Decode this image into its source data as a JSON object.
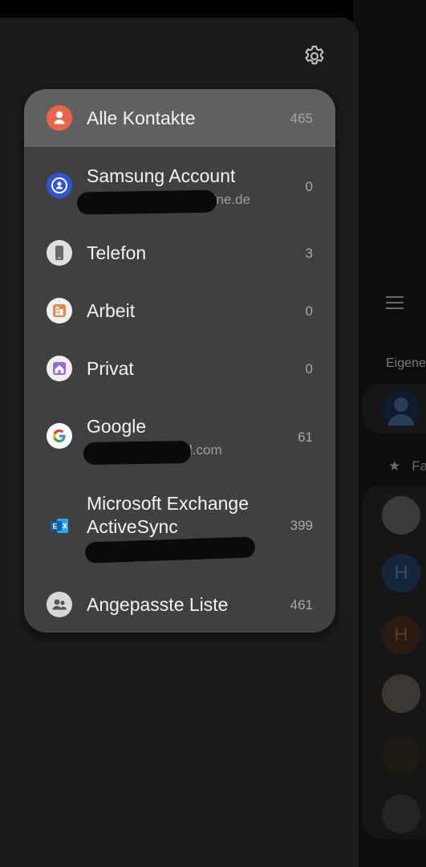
{
  "background_app": {
    "section_label": "Eigene",
    "favorites_label": "Fa",
    "avatar_letter_1": "H",
    "avatar_letter_2": "H"
  },
  "drawer": {
    "settings_icon": "gear-icon"
  },
  "accounts_menu": {
    "items": [
      {
        "label": "Alle Kontakte",
        "sub": "",
        "count": "465",
        "icon": "person-icon",
        "icon_color": "#e8654a",
        "selected": true
      },
      {
        "label": "Samsung Account",
        "sub": "line.de",
        "count": "0",
        "icon": "samsung-account-icon",
        "icon_color": "#2f55d4"
      },
      {
        "label": "Telefon",
        "sub": "",
        "count": "3",
        "icon": "phone-icon",
        "icon_color": "#e0e0e0"
      },
      {
        "label": "Arbeit",
        "sub": "",
        "count": "0",
        "icon": "building-icon",
        "icon_color": "#e08a52"
      },
      {
        "label": "Privat",
        "sub": "",
        "count": "0",
        "icon": "home-icon",
        "icon_color": "#9a6ad0"
      },
      {
        "label": "Google",
        "sub": "l.com",
        "count": "61",
        "icon": "google-icon",
        "icon_color": "#ffffff"
      },
      {
        "label": "Microsoft Exchange",
        "label2": "ActiveSync",
        "sub": "",
        "count": "399",
        "icon": "exchange-icon",
        "icon_color": "#1f6fc2"
      },
      {
        "label": "Angepasste Liste",
        "sub": "",
        "count": "461",
        "icon": "group-icon",
        "icon_color": "#d8d8d8"
      }
    ]
  }
}
